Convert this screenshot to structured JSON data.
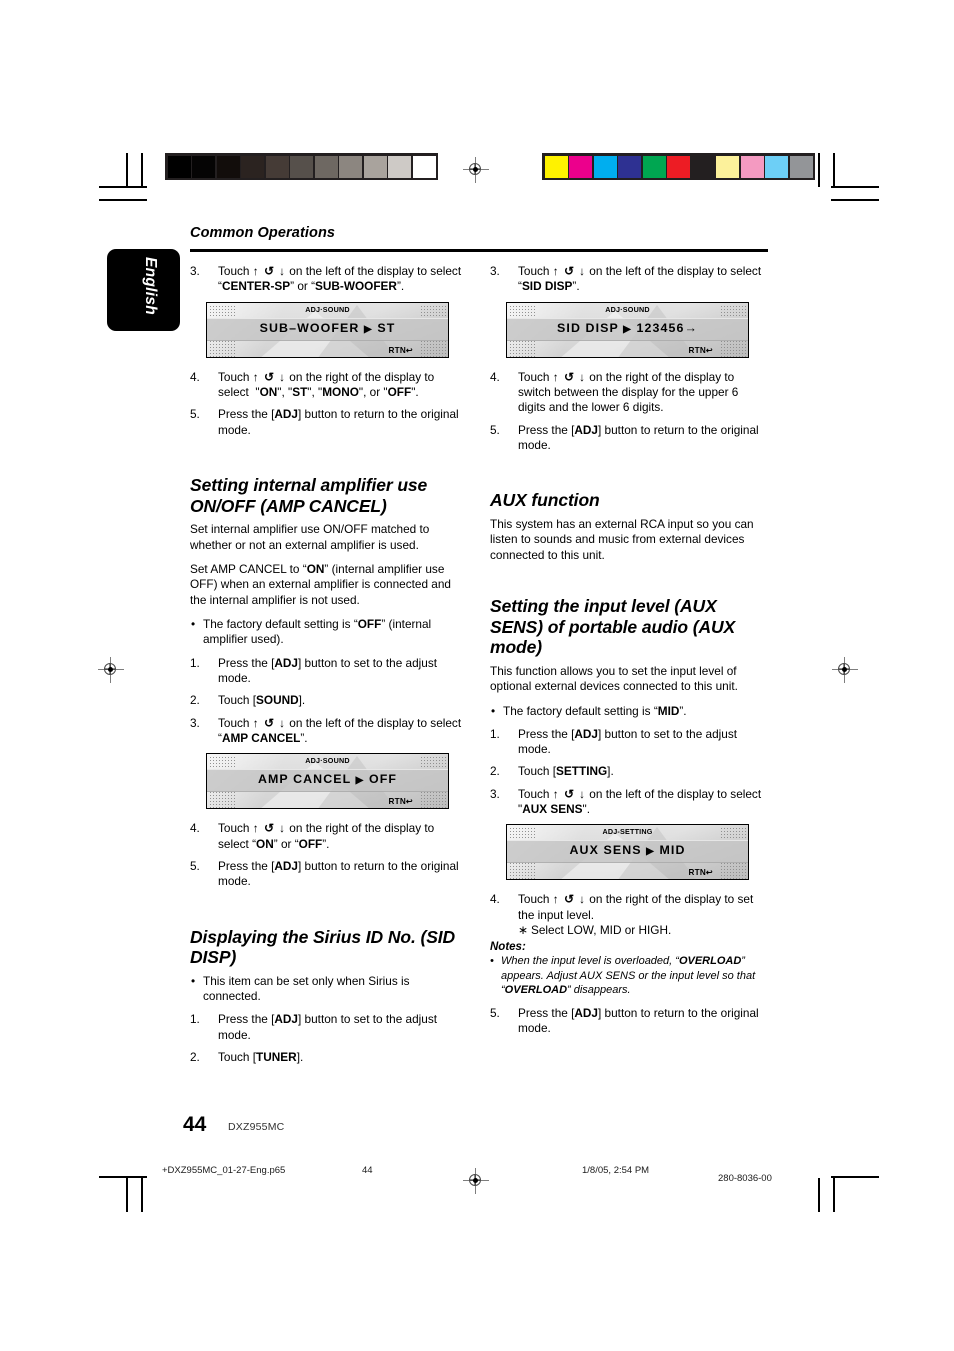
{
  "page": {
    "running_head": "Common Operations",
    "language_tab": "English",
    "page_number": "44",
    "model": "DXZ955MC"
  },
  "footer": {
    "file": "+DXZ955MC_01-27-Eng.p65",
    "page": "44",
    "date": "1/8/05, 2:54 PM",
    "code": "280-8036-00"
  },
  "glyphs": {
    "touch_keys": "↑ ↺ ↓",
    "arrow_right": "▶",
    "rtn": "RTN↩",
    "bullet": "•",
    "star": "∗"
  },
  "left_column": {
    "steps_top": [
      {
        "num": "3.",
        "text_parts": [
          "Touch ",
          "GLYPHS",
          " on the left of the display to select “",
          "CENTER-SP",
          "” or “",
          "SUB-WOOFER",
          "”."
        ],
        "plain": "Touch ↑ ↺ ↓ on the left of the display to select “CENTER-SP” or “SUB-WOOFER”."
      },
      {
        "num": "4.",
        "plain": "Touch ↑ ↺ ↓ on the right of the display to select  “ON”, “ST”, “MONO”, or “OFF”."
      },
      {
        "num": "5.",
        "plain": "Press the [ADJ] button to return to the original mode."
      }
    ],
    "lcd_subwoofer": {
      "header": "ADJ·SOUND",
      "main": "SUB–WOOFER",
      "value": "ST",
      "rtn": "RTN↩"
    },
    "section_amp": {
      "title": "Setting internal amplifier use ON/OFF (AMP CANCEL)",
      "para1": "Set internal amplifier use ON/OFF matched to whether or not an external amplifier is used.",
      "para2_a": "Set AMP CANCEL to “",
      "para2_b": "ON",
      "para2_c": "” (internal amplifier use OFF) when an external amplifier is connected and the internal amplifier is not used.",
      "bullet_a": "The factory default setting is “",
      "bullet_b": "OFF",
      "bullet_c": "” (internal amplifier used).",
      "steps": [
        {
          "num": "1.",
          "plain": "Press the [ADJ] button to set to the adjust mode."
        },
        {
          "num": "2.",
          "plain": "Touch [SOUND]."
        },
        {
          "num": "3.",
          "plain": "Touch ↑ ↺ ↓ on the left of the display to select “AMP CANCEL”."
        }
      ],
      "lcd": {
        "header": "ADJ·SOUND",
        "main": "AMP  CANCEL",
        "value": "OFF",
        "rtn": "RTN↩"
      },
      "steps_after": [
        {
          "num": "4.",
          "plain": "Touch ↑ ↺ ↓ on the right of the display to select “ON” or “OFF”."
        },
        {
          "num": "5.",
          "plain": "Press the [ADJ] button to return to the original mode."
        }
      ]
    },
    "section_sid": {
      "title": "Displaying the Sirius ID No. (SID DISP)",
      "bullet": "This item can be set only when Sirius is connected.",
      "steps": [
        {
          "num": "1.",
          "plain": "Press the [ADJ] button to set to the adjust mode."
        },
        {
          "num": "2.",
          "plain": "Touch [TUNER]."
        }
      ]
    }
  },
  "right_column": {
    "steps_top": [
      {
        "num": "3.",
        "plain": "Touch ↑ ↺ ↓ on the left of the display to select “SID DISP”."
      }
    ],
    "lcd_sid": {
      "header": "ADJ·SOUND",
      "main": "SID  DISP",
      "value": "123456→",
      "rtn": "RTN↩"
    },
    "steps_after": [
      {
        "num": "4.",
        "plain": "Touch ↑ ↺ ↓ on the right of the display to switch between the display for the upper 6 digits and the lower 6 digits."
      },
      {
        "num": "5.",
        "plain": "Press the [ADJ] button to return to the original mode."
      }
    ],
    "section_aux": {
      "title": "AUX function",
      "para": "This system has an external RCA input so you can listen to sounds and music from external devices connected to this unit."
    },
    "section_auxsens": {
      "title": "Setting the input level (AUX SENS) of portable audio (AUX mode)",
      "para": "This function allows you to set the input level of optional external devices connected to this unit.",
      "bullet_a": "The factory default setting is “",
      "bullet_b": "MID",
      "bullet_c": "”.",
      "steps": [
        {
          "num": "1.",
          "plain": "Press the [ADJ] button to set to the adjust mode."
        },
        {
          "num": "2.",
          "plain": "Touch [SETTING]."
        },
        {
          "num": "3.",
          "plain": "Touch ↑ ↺ ↓ on the left of the display to select “AUX SENS”."
        }
      ],
      "lcd": {
        "header": "ADJ-SETTING",
        "main": "AUX  SENS",
        "value": "MID",
        "rtn": "RTN↩"
      },
      "step4": {
        "num": "4.",
        "plain": "Touch ↑ ↺ ↓ on the right of the display to set the input level."
      },
      "substep": "Select LOW, MID or HIGH.",
      "notes_label": "Notes:",
      "note1_a": "When the input level is overloaded, “",
      "note1_b": "OVERLOAD",
      "note1_c": "” appears. Adjust AUX SENS or the input level so that “",
      "note1_d": "OVERLOAD",
      "note1_e": "” disappears.",
      "step5": {
        "num": "5.",
        "plain": "Press the [ADJ] button to return to the original mode."
      }
    }
  },
  "calibration": {
    "grayscale": [
      "#000000",
      "#050404",
      "#120d0b",
      "#2b2320",
      "#453b36",
      "#56504b",
      "#6e6862",
      "#8c8680",
      "#a9a39d",
      "#cecac6",
      "#ffffff"
    ],
    "colors": [
      "#fff200",
      "#ec008c",
      "#00aeef",
      "#2e3192",
      "#00a651",
      "#ed1c24",
      "#231f20",
      "#fcf19b",
      "#f49ac1",
      "#6dcff6",
      "#939598"
    ]
  }
}
